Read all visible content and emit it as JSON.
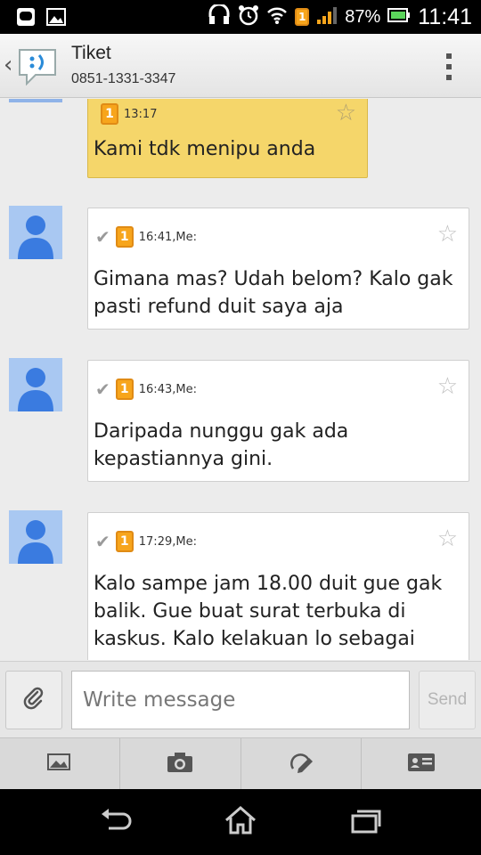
{
  "status_bar": {
    "battery_percent": "87%",
    "time": "11:41",
    "sim_badge": "1"
  },
  "header": {
    "contact_name": "Tiket",
    "contact_phone": "0851-1331-3347"
  },
  "messages": [
    {
      "direction": "incoming",
      "time": "13:17",
      "sim": "1",
      "text": "Kami tdk menipu anda"
    },
    {
      "direction": "outgoing",
      "time": "16:41,Me:",
      "sim": "1",
      "text": "Gimana mas? Udah belom? Kalo gak pasti refund duit saya aja"
    },
    {
      "direction": "outgoing",
      "time": "16:43,Me:",
      "sim": "1",
      "text": "Daripada nunggu gak ada kepastiannya gini."
    },
    {
      "direction": "outgoing",
      "time": "17:29,Me:",
      "sim": "1",
      "text": "Kalo sampe jam 18.00 duit gue gak balik. Gue buat surat terbuka di kaskus. Kalo kelakuan lo sebagai"
    }
  ],
  "composer": {
    "placeholder": "Write message",
    "send_label": "Send"
  },
  "colors": {
    "incoming_bubble": "#f5d66a",
    "outgoing_bubble": "#ffffff",
    "avatar_bg": "#a9c8f2",
    "avatar_fg": "#3a7be0"
  }
}
